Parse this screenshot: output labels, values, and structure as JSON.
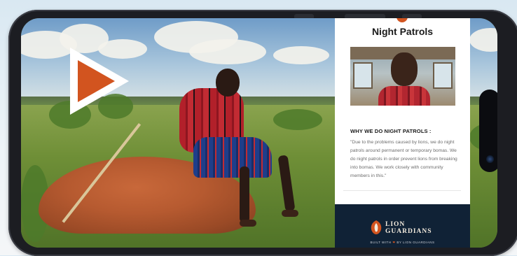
{
  "card": {
    "title": "Night Patrols",
    "section_heading": "WHY WE DO NIGHT PATROLS :",
    "section_body": "\"Due to the problems caused by lions, we do night patrols around permanent or temporary bomas. We do night patrols in order prevent lions from breaking into bomas. We work closely with community members in this.\""
  },
  "footer": {
    "logo_line1": "LION",
    "logo_line2": "GUARDIANS",
    "built_with_prefix": "BUILT WITH",
    "built_with_suffix": "BY LION GUARDIANS"
  },
  "icons": {
    "play": "play-triangle-icon",
    "logo": "lion-guardians-logo-icon",
    "heart": "heart-icon",
    "camera": "camera-lens-icon"
  },
  "colors": {
    "accent_orange": "#d2541f",
    "footer_navy": "#102236",
    "card_bg": "#ffffff"
  }
}
